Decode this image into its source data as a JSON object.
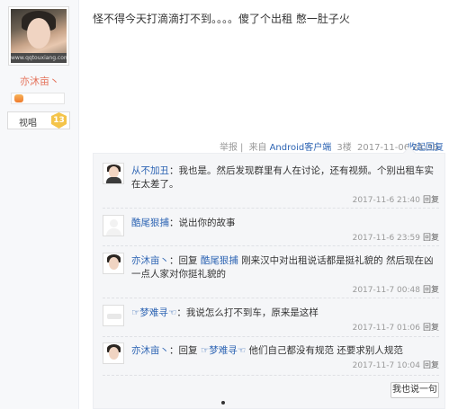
{
  "author": {
    "name": "亦沐亩丶",
    "avatar_caption": "www.qqtouxiang.com",
    "badge_name": "视唱",
    "badge_level": "13"
  },
  "post": {
    "text": "怪不得今天打滴滴打不到。。。。傻了个出租 憋一肚子火"
  },
  "tail": {
    "report": "举报",
    "source_prefix": "来自",
    "source_link": "Android客户端",
    "floor": "3楼",
    "time": "2017-11-06 21:38",
    "collapse_label": "收起回复"
  },
  "replies": [
    {
      "avatar": "woman-avatar",
      "nick": "从不加丑",
      "text": "我也是。然后发现群里有人在讨论，还有视频。个别出租车实在太差了。",
      "time": "2017-11-6 21:40",
      "reply_label": "回复"
    },
    {
      "avatar": "default-user-avatar",
      "nick": "酷尾狠捕",
      "text": "说出你的故事",
      "time": "2017-11-6 23:59",
      "reply_label": "回复"
    },
    {
      "avatar": "author-avatar",
      "nick": "亦沐亩丶",
      "reply_prefix": "回复",
      "target": "酷尾狠捕",
      "text": "刚来汉中对出租说话都是挺礼貌的 然后现在凶一点人家对你挺礼貌的",
      "time": "2017-11-7 00:48",
      "reply_label": "回复"
    },
    {
      "avatar": "landscape-avatar",
      "nick": "☞梦难寻☜",
      "text": "我说怎么打不到车，原来是这样",
      "time": "2017-11-7 01:06",
      "reply_label": "回复"
    },
    {
      "avatar": "author-avatar",
      "nick": "亦沐亩丶",
      "reply_prefix": "回复",
      "target": "☞梦难寻☜",
      "text": "他们自己都没有规范 还要求别人规范",
      "time": "2017-11-7 10:04",
      "reply_label": "回复"
    }
  ],
  "say_button": "我也说一句"
}
